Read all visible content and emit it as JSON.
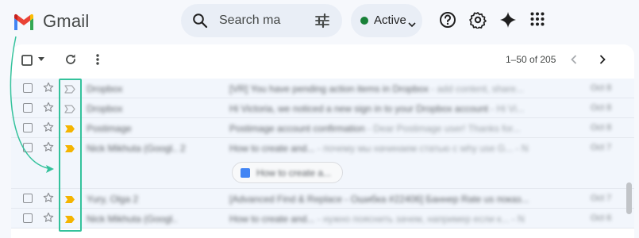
{
  "header": {
    "app_name": "Gmail",
    "logo_icon": "gmail-m-icon",
    "search": {
      "value": "Search ma",
      "icon": "search-icon",
      "filter_icon": "search-options-icon"
    },
    "status": {
      "label": "Active",
      "color": "#188038"
    },
    "icons": [
      "help-icon",
      "settings-icon",
      "gemini-icon",
      "apps-grid-icon"
    ]
  },
  "toolbar": {
    "pager": "1–50 of 205",
    "icons": [
      "select-all-checkbox",
      "select-dropdown-icon",
      "refresh-icon",
      "more-options-icon",
      "prev-page-icon",
      "next-page-icon"
    ]
  },
  "emails": [
    {
      "sender": "Dropbox",
      "subject": "[VR] You have pending action items in Dropbox",
      "snippet": " - add content, share...",
      "date": "Oct 8",
      "important": false
    },
    {
      "sender": "Dropbox",
      "subject": "Hi Victoria, we noticed a new sign in to your Dropbox account",
      "snippet": " - Hi Vi...",
      "date": "Oct 8",
      "important": false
    },
    {
      "sender": "Postimage",
      "subject": "Postimage account confirmation",
      "snippet": " - Dear Postimage user! Thanks for...",
      "date": "Oct 8",
      "important": true
    },
    {
      "sender": "Nick Mikhuta (Googl.. 2",
      "subject": "How to create and... ",
      "snippet": "- почему мы начинаем статью с why use G... - N",
      "date": "Oct 7",
      "important": true
    },
    {
      "sender": "Yury, Olga 2",
      "subject": "[Advanced Find & Replace - Ошибка #22406] Баннер Rate us показ...",
      "snippet": "",
      "date": "Oct 7",
      "important": true
    },
    {
      "sender": "Nick Mikhuta (Googl..",
      "subject": "How to create and... ",
      "snippet": "- нужно пояснить зачем, например если к... - N",
      "date": "Oct 6",
      "important": true
    }
  ],
  "expanded_chip": {
    "label": "How to create a..."
  },
  "colors": {
    "important": "#f4b400",
    "highlight": "#34c29c",
    "row_bg": "#f2f6fc"
  }
}
